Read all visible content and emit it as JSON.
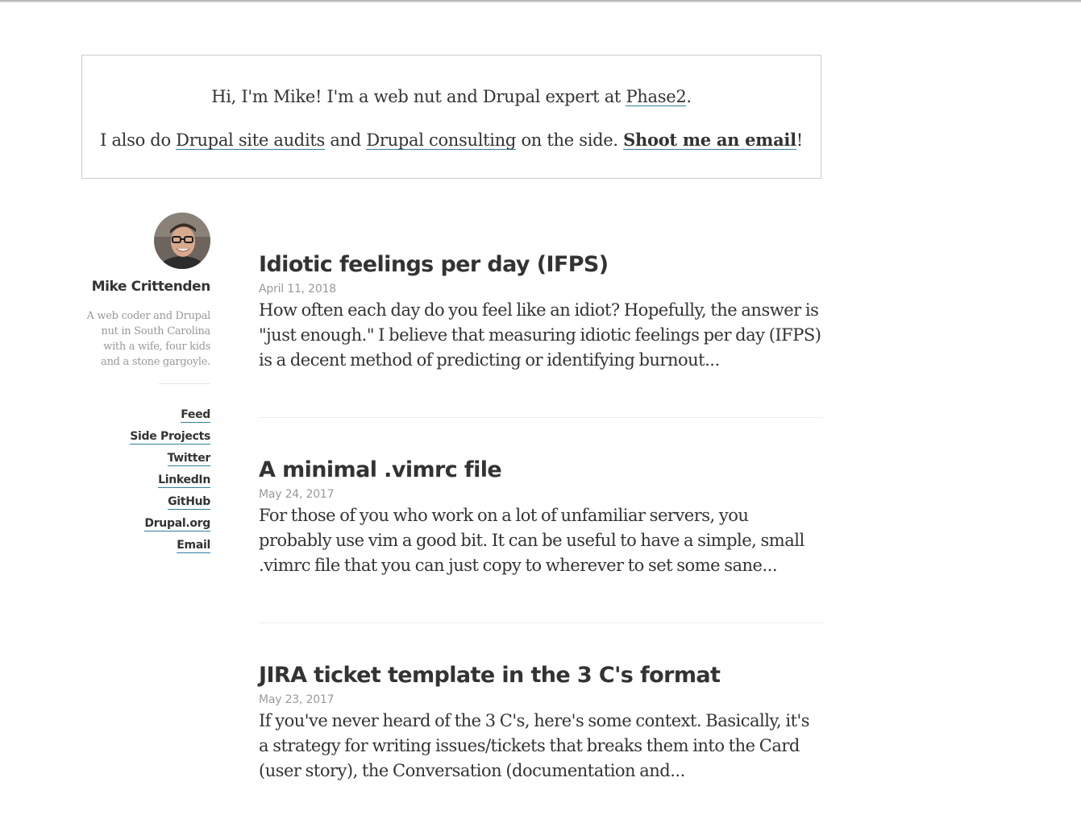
{
  "intro": {
    "line1_pre": "Hi, I'm Mike! I'm a web nut and Drupal expert at ",
    "line1_link": "Phase2",
    "line1_post": ".",
    "line2_pre": "I also do ",
    "audits_link": "Drupal site audits",
    "line2_mid": " and ",
    "consulting_link": "Drupal consulting",
    "line2_mid2": " on the side. ",
    "email_link": "Shoot me an email",
    "line2_post": "!"
  },
  "sidebar": {
    "avatar_icon": "avatar-photo",
    "name": "Mike Crittenden",
    "bio": "A web coder and Drupal nut in South Carolina with a wife, four kids and a stone gargoyle.",
    "nav": [
      "Feed",
      "Side Projects",
      "Twitter",
      "LinkedIn",
      "GitHub",
      "Drupal.org",
      "Email"
    ]
  },
  "posts": [
    {
      "title": "Idiotic feelings per day (IFPS)",
      "date": "April 11, 2018",
      "excerpt": "How often each day do you feel like an idiot? Hopefully, the answer is \"just enough.\" I believe that measuring idiotic feelings per day (IFPS) is a decent method of predicting or identifying burnout..."
    },
    {
      "title": "A minimal .vimrc file",
      "date": "May 24, 2017",
      "excerpt": "For those of you who work on a lot of unfamiliar servers, you probably use vim a good bit. It can be useful to have a simple, small .vimrc file that you can just copy to wherever to set some sane..."
    },
    {
      "title": "JIRA ticket template in the 3 C's format",
      "date": "May 23, 2017",
      "excerpt": "If you've never heard of the 3 C's, here's some context. Basically, it's a strategy for writing issues/tickets that breaks them into the Card (user story), the Conversation (documentation and..."
    }
  ],
  "colors": {
    "text": "#333333",
    "muted": "#999999",
    "link_underline": "#2f7fa0",
    "border": "#cccccc"
  }
}
